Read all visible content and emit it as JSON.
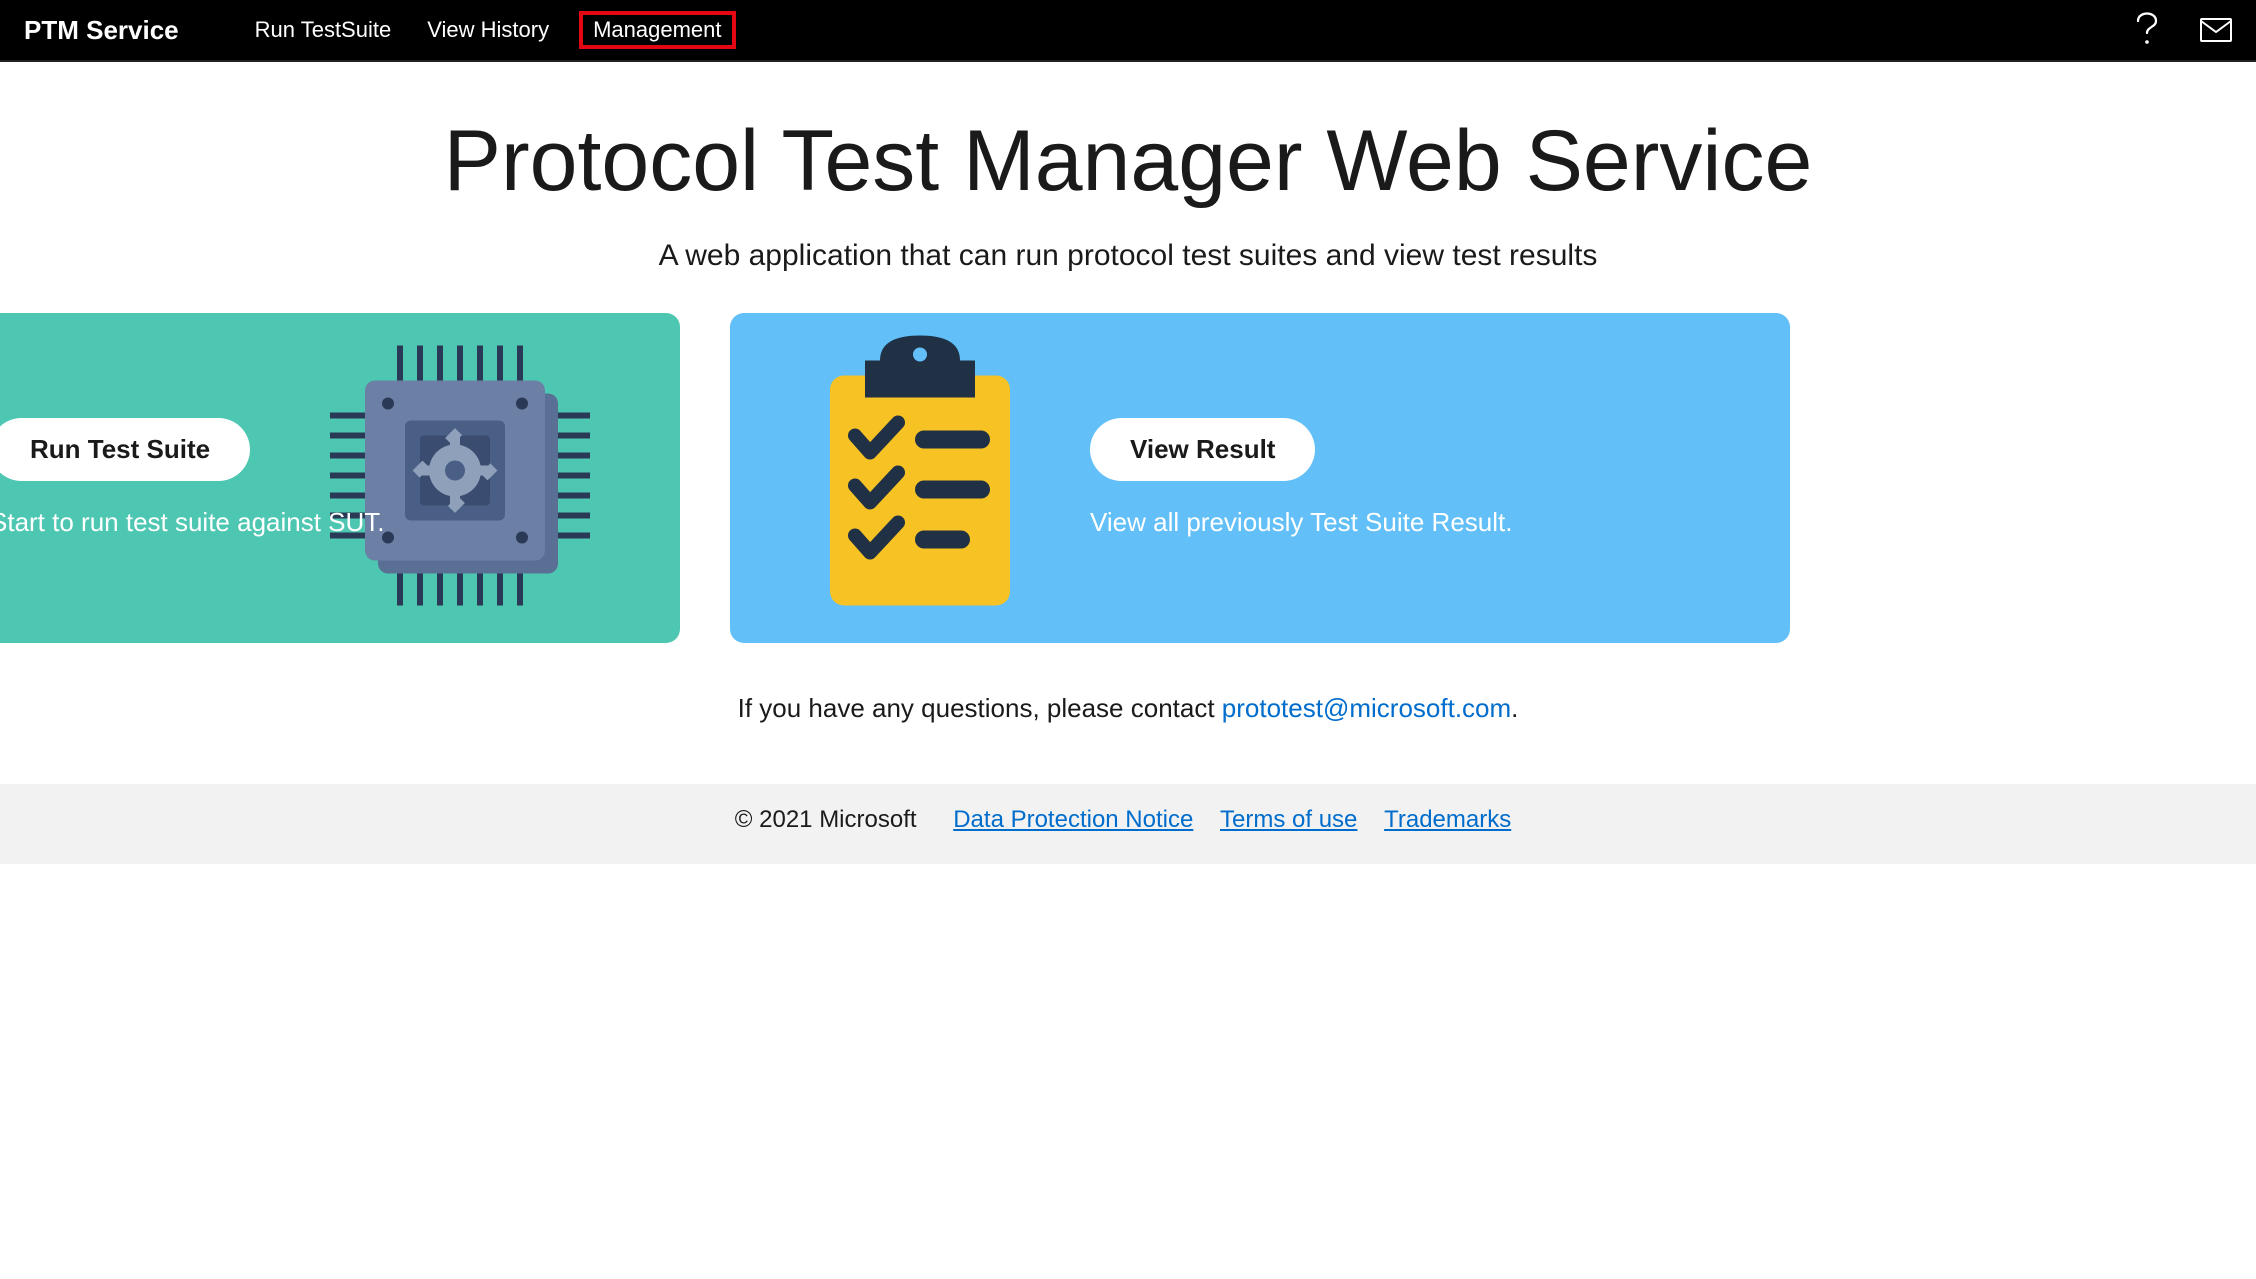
{
  "nav": {
    "brand": "PTM Service",
    "links": [
      "Run TestSuite",
      "View History",
      "Management"
    ],
    "highlighted_index": 2
  },
  "hero": {
    "title": "Protocol Test Manager Web Service",
    "subtitle": "A web application that can run protocol test suites and view test results"
  },
  "cards": {
    "left": {
      "button": "Run Test Suite",
      "desc": "Start to run test suite against SUT."
    },
    "right": {
      "button": "View Result",
      "desc": "View all previously Test Suite Result."
    }
  },
  "contact": {
    "prefix": "If you have any questions, please contact ",
    "email": "prototest@microsoft.com",
    "suffix": "."
  },
  "footer": {
    "copyright": "© 2021 Microsoft",
    "links": [
      "Data Protection Notice",
      "Terms of use",
      "Trademarks"
    ]
  }
}
